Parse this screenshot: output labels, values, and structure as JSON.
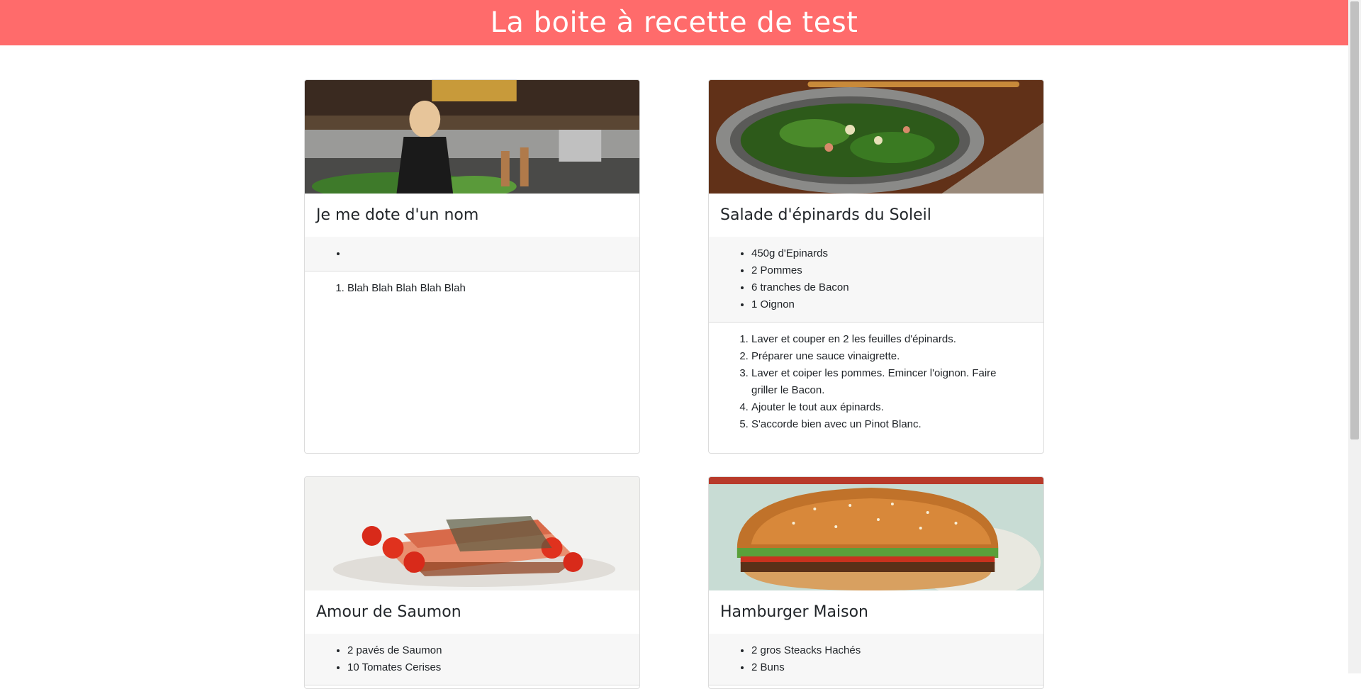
{
  "header": {
    "title": "La boite à recette de test"
  },
  "recipes": [
    {
      "title": "Je me dote d'un nom",
      "image": "chef-kitchen-photo",
      "ingredients": [
        ""
      ],
      "steps": [
        "Blah Blah Blah Blah Blah"
      ]
    },
    {
      "title": "Salade d'épinards du Soleil",
      "image": "spinach-salad-photo",
      "ingredients": [
        "450g d'Epinards",
        " 2 Pommes",
        " 6 tranches de Bacon",
        " 1 Oignon"
      ],
      "steps": [
        "Laver et couper en 2 les feuilles d'épinards.",
        "Préparer une sauce vinaigrette.",
        "Laver et coiper les pommes. Emincer l'oignon. Faire griller le Bacon.",
        "Ajouter le tout aux épinards.",
        "S'accorde bien avec un Pinot Blanc."
      ]
    },
    {
      "title": "Amour de Saumon",
      "image": "salmon-dish-photo",
      "ingredients": [
        "2 pavés de Saumon",
        " 10 Tomates Cerises"
      ],
      "steps": []
    },
    {
      "title": "Hamburger Maison",
      "image": "hamburger-photo",
      "ingredients": [
        "2 gros Steacks Hachés",
        " 2 Buns"
      ],
      "steps": []
    }
  ],
  "colors": {
    "header": "#ff6b6b",
    "ingredients_bg": "#f7f7f7"
  }
}
